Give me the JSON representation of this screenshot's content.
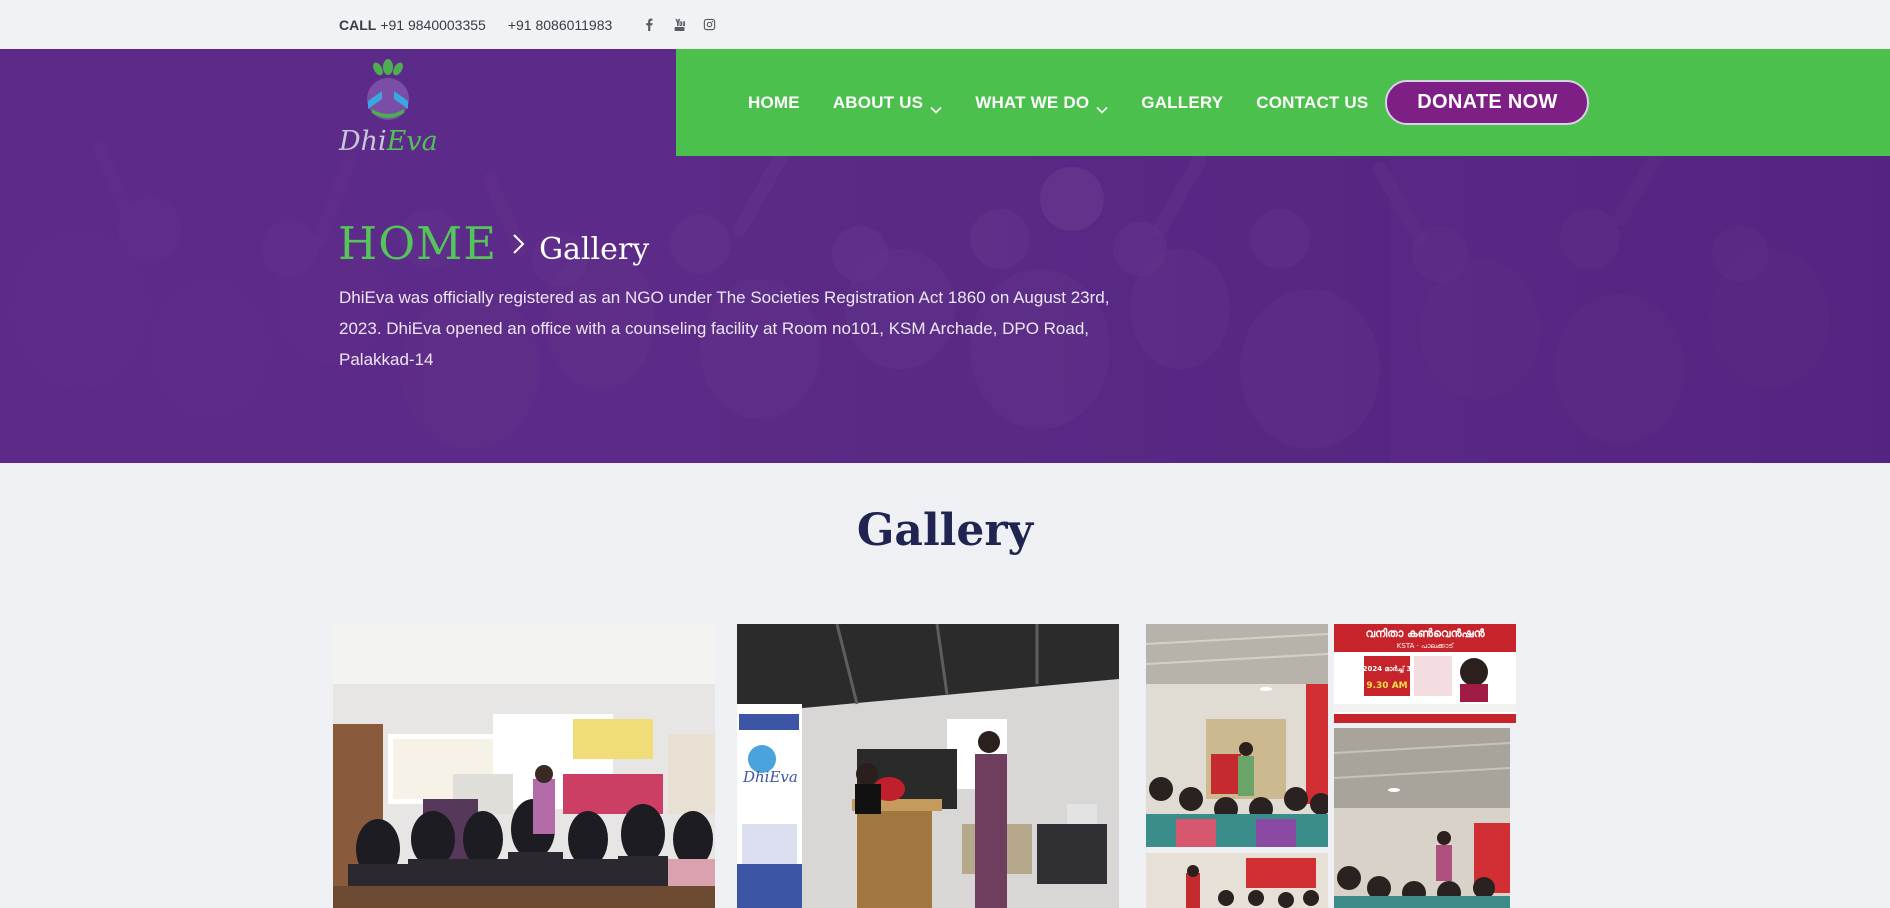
{
  "topbar": {
    "call_label": "CALL",
    "phone1": "+91 9840003355",
    "phone2": "+91 8086011983",
    "socials": [
      "facebook-icon",
      "youtube-icon",
      "instagram-icon"
    ]
  },
  "brand": {
    "logo_part1": "Dhi",
    "logo_part2": "Eva"
  },
  "nav": {
    "items": [
      {
        "label": "HOME",
        "dropdown": false
      },
      {
        "label": "ABOUT US",
        "dropdown": true
      },
      {
        "label": "WHAT WE DO",
        "dropdown": true
      },
      {
        "label": "GALLERY",
        "dropdown": false
      },
      {
        "label": "CONTACT US",
        "dropdown": false
      }
    ],
    "donate_label": "DONATE NOW"
  },
  "hero": {
    "breadcrumb_home": "HOME",
    "breadcrumb_current": "Gallery",
    "description": "DhiEva was officially registered as an NGO under The Societies Registration Act 1860 on August 23rd, 2023. DhiEva opened an office with a counseling facility at Room no101, KSM Archade, DPO Road, Palakkad-14"
  },
  "gallery": {
    "title": "Gallery",
    "poster_title": "വനിതാ കൺവെൻഷൻ",
    "poster_sub": "KSTA · പാലക്കാട്",
    "poster_date": "2024 മാർച്ച് 3",
    "poster_time": "9.30 AM",
    "banner_text": "DhiEva"
  },
  "colors": {
    "brand_purple": "#5a2a86",
    "brand_green": "#4bc04d",
    "donate_bg": "#7e1f86",
    "title_navy": "#1f2550"
  }
}
